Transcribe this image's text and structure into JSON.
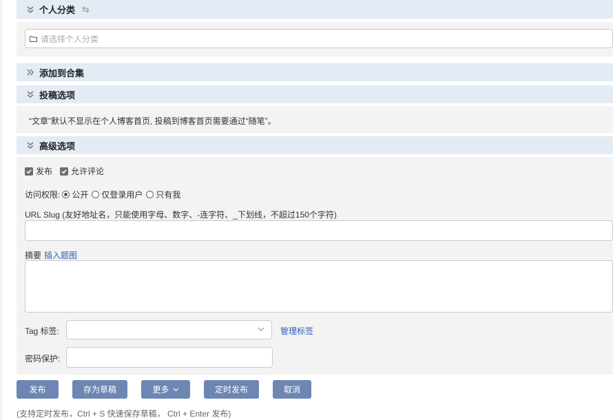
{
  "personal_category": {
    "title": "个人分类",
    "swap_icon": "⇆",
    "placeholder": "请选择个人分类"
  },
  "collection": {
    "title": "添加到合集"
  },
  "submission": {
    "title": "投稿选项",
    "notice": "“文章”默认不显示在个人博客首页, 投稿到博客首页需要通过“随笔”。"
  },
  "advanced": {
    "title": "高级选项",
    "publish_label": "发布",
    "publish_checked": true,
    "allow_comments_label": "允许评论",
    "allow_comments_checked": true,
    "access_label": "访问权限:",
    "access_options": [
      "公开",
      "仅登录用户",
      "只有我"
    ],
    "access_selected": "公开",
    "slug_label": "URL Slug (友好地址名，只能使用字母、数字、-连字符、_下划线，不超过150个字符)",
    "summary_label": "摘要",
    "insert_image_link": "插入题图",
    "tag_label": "Tag 标签:",
    "manage_tags_link": "管理标签",
    "password_label": "密码保护:"
  },
  "buttons": {
    "publish": "发布",
    "save_draft": "存为草稿",
    "more": "更多",
    "scheduled": "定时发布",
    "cancel": "取消"
  },
  "hint": "(支持定时发布，Ctrl + S 快速保存草稿， Ctrl + Enter 发布)",
  "colors": {
    "header_bg": "#e3ebf5",
    "body_bg": "#f3f3f3",
    "button_bg": "#6d86b3",
    "link": "#2a5dbb"
  }
}
